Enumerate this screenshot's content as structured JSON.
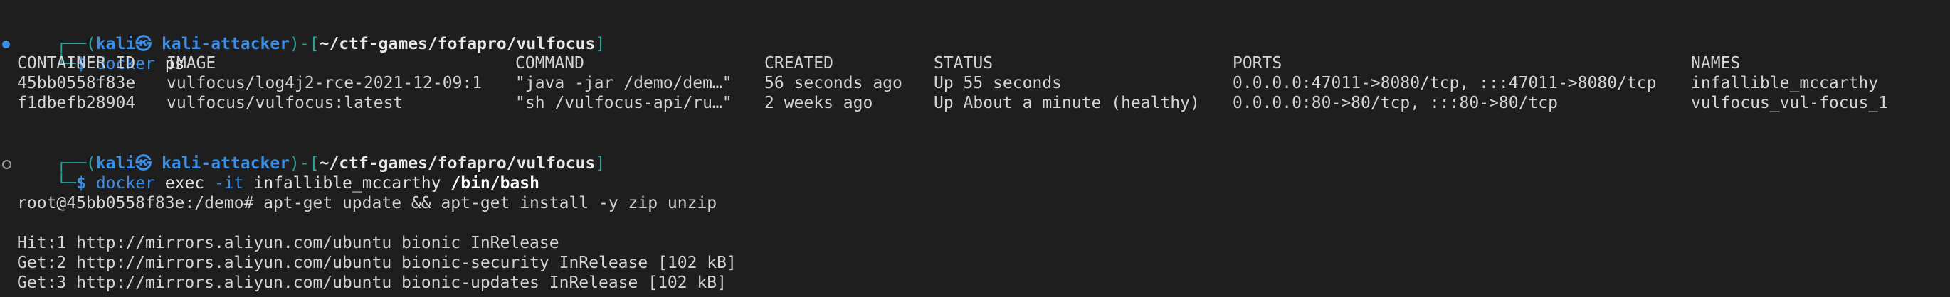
{
  "prompt": {
    "frame_open": "┌──(",
    "user_host": "kali㉿ kali-attacker",
    "frame_mid": ")-[",
    "path": "~/ctf-games/fofapro/vulfocus",
    "frame_close": "]",
    "frame_bottom": "└─",
    "dollar": "$"
  },
  "cmd1": {
    "name": "docker",
    "args": " ps"
  },
  "docker_ps": {
    "headers": [
      "CONTAINER ID",
      "IMAGE",
      "COMMAND",
      "CREATED",
      "STATUS",
      "PORTS",
      "NAMES"
    ],
    "rows": [
      [
        "45bb0558f83e",
        "vulfocus/log4j2-rce-2021-12-09:1",
        "\"java -jar /demo/dem…\"",
        "56 seconds ago",
        "Up 55 seconds",
        "0.0.0.0:47011->8080/tcp, :::47011->8080/tcp",
        "infallible_mccarthy"
      ],
      [
        "f1dbefb28904",
        "vulfocus/vulfocus:latest",
        "\"sh /vulfocus-api/ru…\"",
        "2 weeks ago",
        "Up About a minute (healthy)",
        "0.0.0.0:80->80/tcp, :::80->80/tcp",
        "vulfocus_vul-focus_1"
      ]
    ]
  },
  "cmd2": {
    "name": "docker",
    "sub": " exec ",
    "flag": "-it",
    "target": " infallible_mccarthy ",
    "shell": "/bin/bash"
  },
  "container_cmd": "root@45bb0558f83e:/demo# apt-get update && apt-get install -y zip unzip",
  "apt_output": [
    "Hit:1 http://mirrors.aliyun.com/ubuntu bionic InRelease",
    "Get:2 http://mirrors.aliyun.com/ubuntu bionic-security InRelease [102 kB]",
    "Get:3 http://mirrors.aliyun.com/ubuntu bionic-updates InRelease [102 kB]"
  ],
  "colors": {
    "background": "#1e1e1e",
    "accent_blue": "#3b8ee5",
    "frame_teal": "#2aa198",
    "text": "#d4d4d4"
  }
}
